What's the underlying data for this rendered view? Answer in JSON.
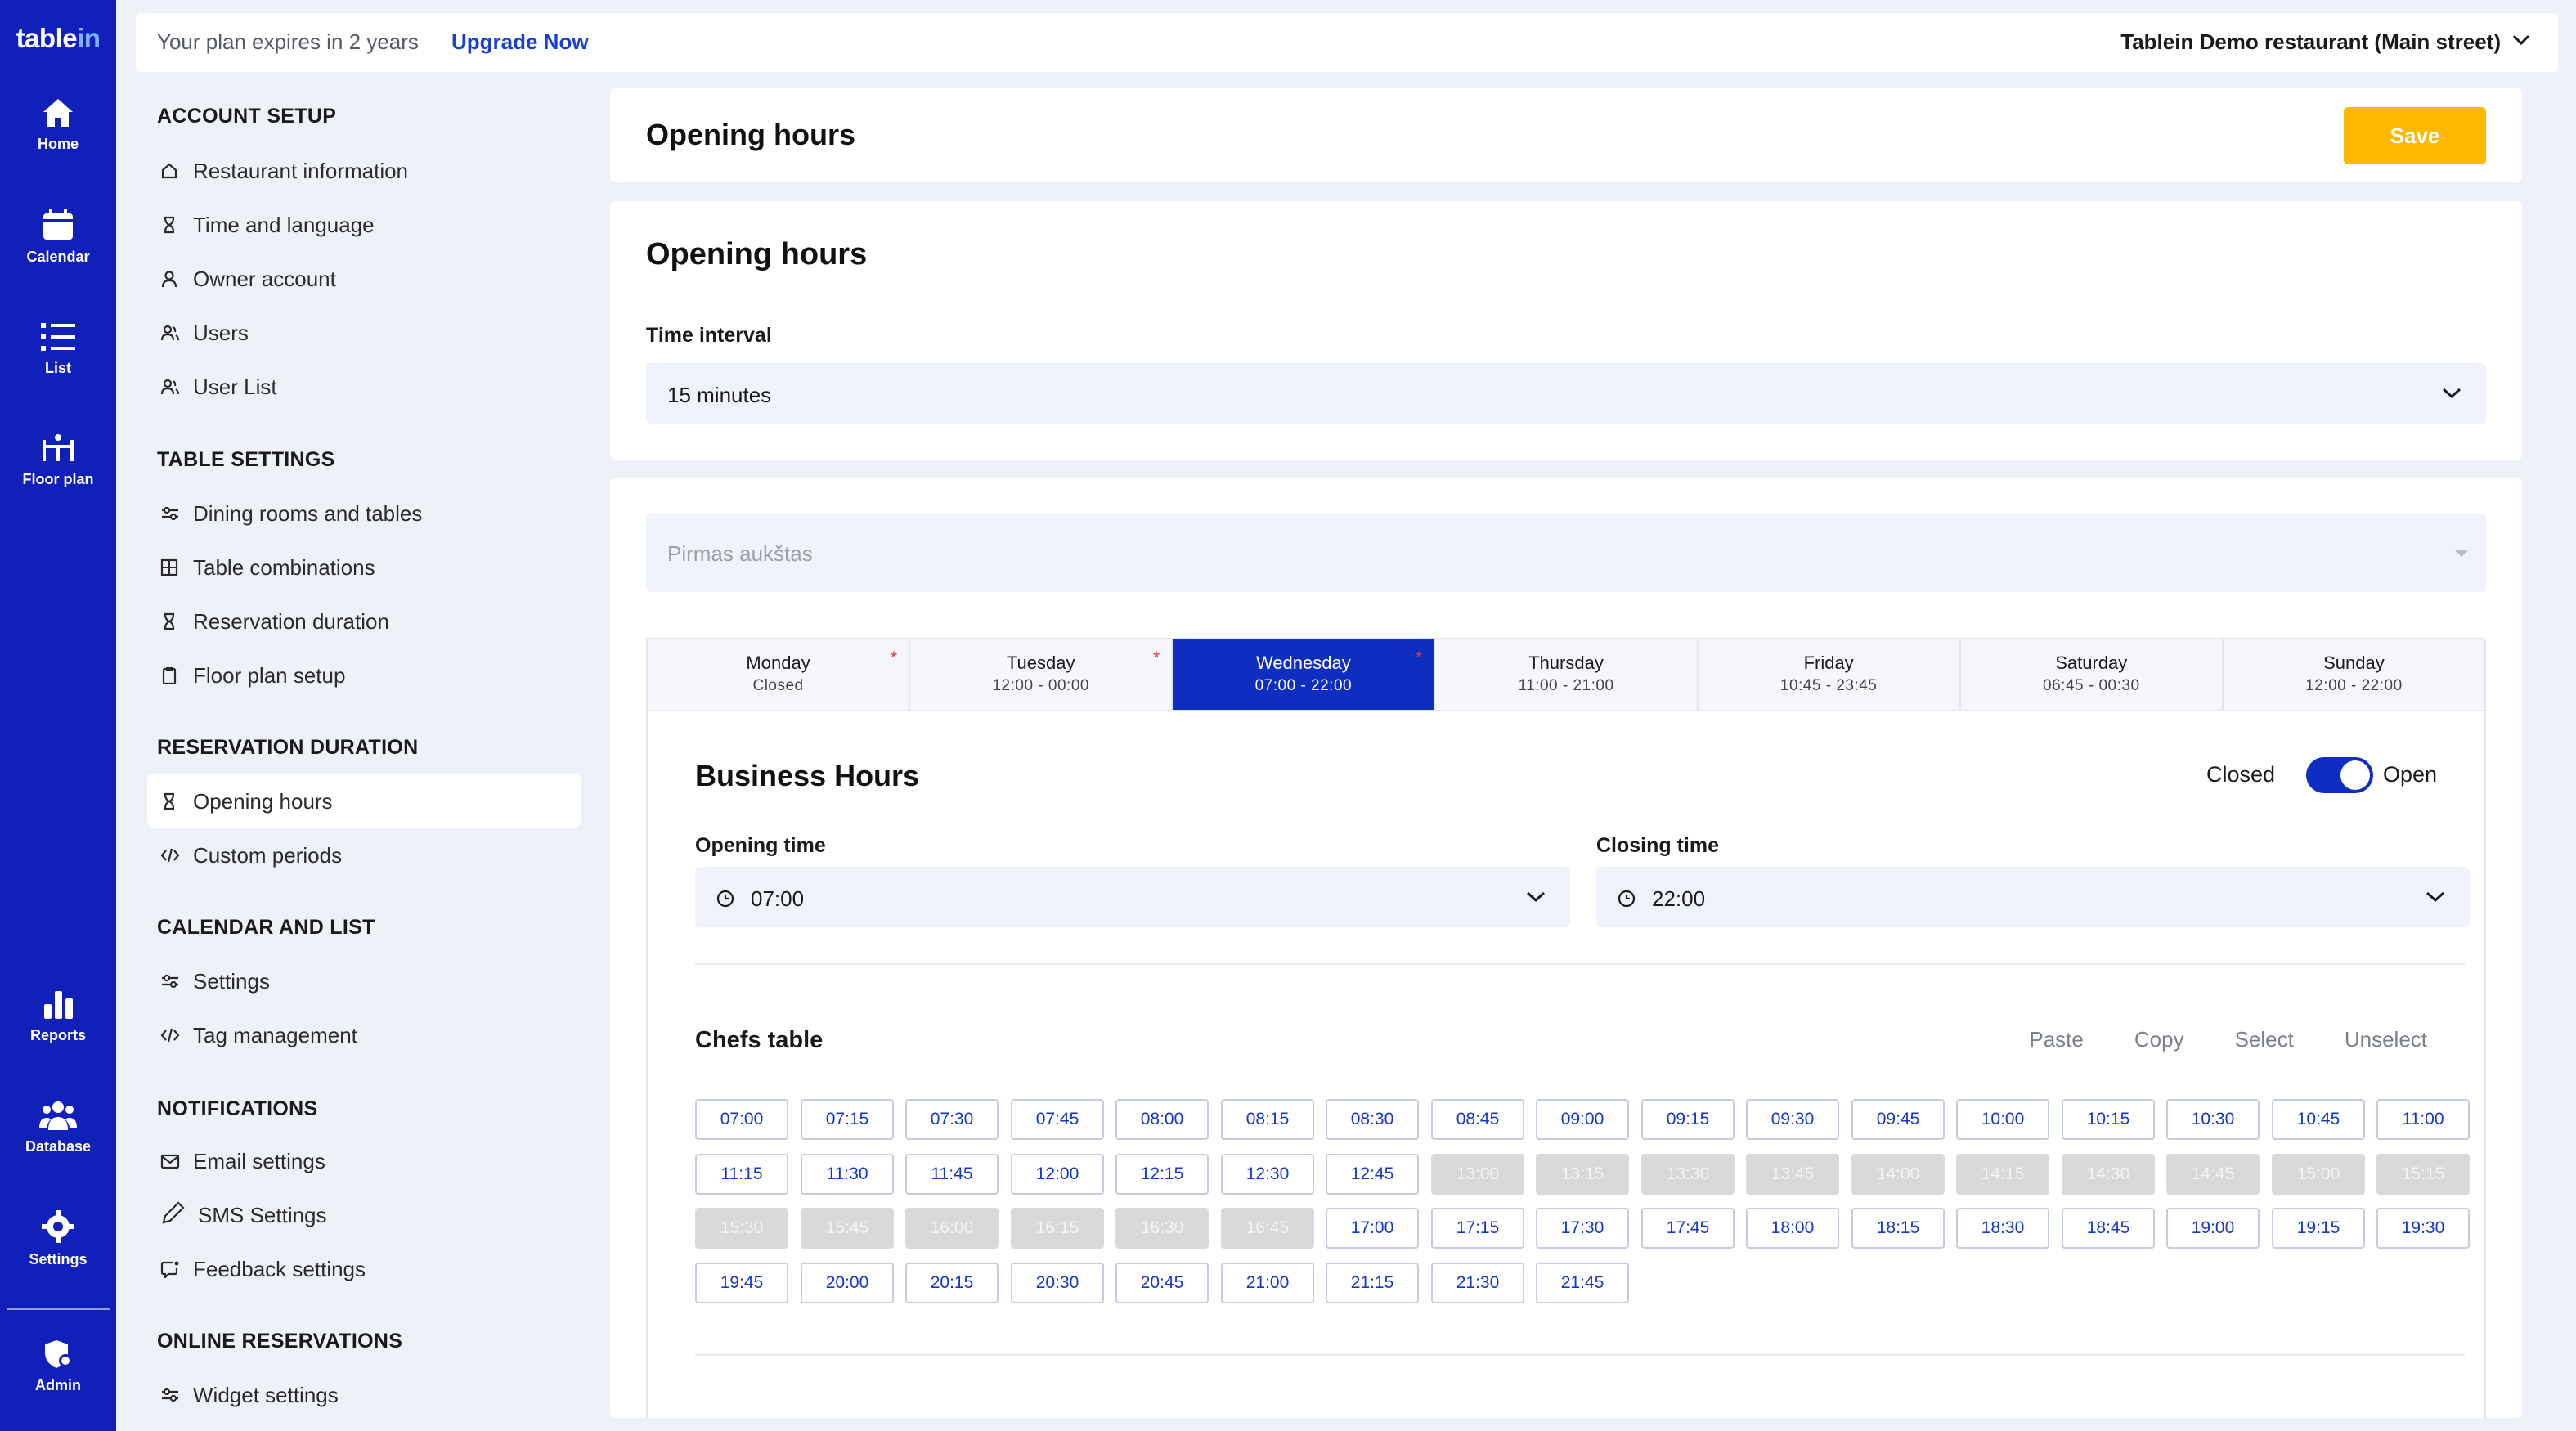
{
  "rail": {
    "logo_a": "table",
    "logo_b": "in",
    "items": [
      {
        "label": "Home",
        "icon": "home-icon"
      },
      {
        "label": "Calendar",
        "icon": "calendar-icon"
      },
      {
        "label": "List",
        "icon": "list-icon"
      },
      {
        "label": "Floor plan",
        "icon": "floor-plan-icon"
      },
      {
        "label": "Reports",
        "icon": "reports-icon"
      },
      {
        "label": "Database",
        "icon": "database-icon"
      },
      {
        "label": "Settings",
        "icon": "settings-icon"
      },
      {
        "label": "Admin",
        "icon": "admin-icon"
      }
    ]
  },
  "topbar": {
    "plan_text": "Your plan expires in 2 years",
    "upgrade_label": "Upgrade Now",
    "restaurant_name": "Tablein Demo restaurant (Main street)"
  },
  "nav": {
    "sections": [
      {
        "title": "ACCOUNT SETUP",
        "items": [
          {
            "label": "Restaurant information",
            "icon": "house-outline-icon"
          },
          {
            "label": "Time and language",
            "icon": "hourglass-icon"
          },
          {
            "label": "Owner account",
            "icon": "user-icon"
          },
          {
            "label": "Users",
            "icon": "users-icon"
          },
          {
            "label": "User List",
            "icon": "users-icon"
          }
        ]
      },
      {
        "title": "TABLE SETTINGS",
        "items": [
          {
            "label": "Dining rooms and tables",
            "icon": "sliders-icon"
          },
          {
            "label": "Table combinations",
            "icon": "grid-icon"
          },
          {
            "label": "Reservation duration",
            "icon": "hourglass-icon"
          },
          {
            "label": "Floor plan setup",
            "icon": "clipboard-icon"
          }
        ]
      },
      {
        "title": "RESERVATION DURATION",
        "items": [
          {
            "label": "Opening hours",
            "icon": "hourglass-icon",
            "active": true
          },
          {
            "label": "Custom periods",
            "icon": "code-icon"
          }
        ]
      },
      {
        "title": "CALENDAR AND LIST",
        "items": [
          {
            "label": "Settings",
            "icon": "sliders-icon"
          },
          {
            "label": "Tag management",
            "icon": "code-icon"
          }
        ]
      },
      {
        "title": "NOTIFICATIONS",
        "items": [
          {
            "label": "Email settings",
            "icon": "mail-icon"
          },
          {
            "label": "SMS Settings",
            "icon": "pen-icon"
          },
          {
            "label": "Feedback settings",
            "icon": "feedback-icon"
          }
        ]
      },
      {
        "title": "ONLINE RESERVATIONS",
        "items": [
          {
            "label": "Widget settings",
            "icon": "sliders-icon"
          }
        ]
      }
    ]
  },
  "header": {
    "title": "Opening hours",
    "save_label": "Save"
  },
  "opening_hours": {
    "title": "Opening hours",
    "interval_label": "Time interval",
    "interval_value": "15 minutes"
  },
  "rooms": {
    "placeholder": "Pirmas aukštas",
    "days": [
      {
        "day": "Monday",
        "hours": "Closed",
        "star": true
      },
      {
        "day": "Tuesday",
        "hours": "12:00 - 00:00",
        "star": true
      },
      {
        "day": "Wednesday",
        "hours": "07:00 - 22:00",
        "star": true,
        "active": true
      },
      {
        "day": "Thursday",
        "hours": "11:00 - 21:00",
        "star": false
      },
      {
        "day": "Friday",
        "hours": "10:45 - 23:45",
        "star": false
      },
      {
        "day": "Saturday",
        "hours": "06:45 - 00:30",
        "star": false
      },
      {
        "day": "Sunday",
        "hours": "12:00 - 22:00",
        "star": false
      }
    ]
  },
  "business_hours": {
    "title": "Business Hours",
    "closed_label": "Closed",
    "open_label": "Open",
    "toggle_on": true,
    "opening_label": "Opening time",
    "opening_value": "07:00",
    "closing_label": "Closing time",
    "closing_value": "22:00"
  },
  "chefs_table": {
    "title": "Chefs table",
    "actions": [
      "Paste",
      "Copy",
      "Select",
      "Unselect"
    ],
    "slots": [
      {
        "t": "07:00",
        "on": true
      },
      {
        "t": "07:15",
        "on": true
      },
      {
        "t": "07:30",
        "on": true
      },
      {
        "t": "07:45",
        "on": true
      },
      {
        "t": "08:00",
        "on": true
      },
      {
        "t": "08:15",
        "on": true
      },
      {
        "t": "08:30",
        "on": true
      },
      {
        "t": "08:45",
        "on": true
      },
      {
        "t": "09:00",
        "on": true
      },
      {
        "t": "09:15",
        "on": true
      },
      {
        "t": "09:30",
        "on": true
      },
      {
        "t": "09:45",
        "on": true
      },
      {
        "t": "10:00",
        "on": true
      },
      {
        "t": "10:15",
        "on": true
      },
      {
        "t": "10:30",
        "on": true
      },
      {
        "t": "10:45",
        "on": true
      },
      {
        "t": "11:00",
        "on": true
      },
      {
        "t": "11:15",
        "on": true
      },
      {
        "t": "11:30",
        "on": true
      },
      {
        "t": "11:45",
        "on": true
      },
      {
        "t": "12:00",
        "on": true
      },
      {
        "t": "12:15",
        "on": true
      },
      {
        "t": "12:30",
        "on": true
      },
      {
        "t": "12:45",
        "on": true
      },
      {
        "t": "13:00",
        "on": false
      },
      {
        "t": "13:15",
        "on": false
      },
      {
        "t": "13:30",
        "on": false
      },
      {
        "t": "13:45",
        "on": false
      },
      {
        "t": "14:00",
        "on": false
      },
      {
        "t": "14:15",
        "on": false
      },
      {
        "t": "14:30",
        "on": false
      },
      {
        "t": "14:45",
        "on": false
      },
      {
        "t": "15:00",
        "on": false
      },
      {
        "t": "15:15",
        "on": false
      },
      {
        "t": "15:30",
        "on": false
      },
      {
        "t": "15:45",
        "on": false
      },
      {
        "t": "16:00",
        "on": false
      },
      {
        "t": "16:15",
        "on": false
      },
      {
        "t": "16:30",
        "on": false
      },
      {
        "t": "16:45",
        "on": false
      },
      {
        "t": "17:00",
        "on": true
      },
      {
        "t": "17:15",
        "on": true
      },
      {
        "t": "17:30",
        "on": true
      },
      {
        "t": "17:45",
        "on": true
      },
      {
        "t": "18:00",
        "on": true
      },
      {
        "t": "18:15",
        "on": true
      },
      {
        "t": "18:30",
        "on": true
      },
      {
        "t": "18:45",
        "on": true
      },
      {
        "t": "19:00",
        "on": true
      },
      {
        "t": "19:15",
        "on": true
      },
      {
        "t": "19:30",
        "on": true
      },
      {
        "t": "19:45",
        "on": true
      },
      {
        "t": "20:00",
        "on": true
      },
      {
        "t": "20:15",
        "on": true
      },
      {
        "t": "20:30",
        "on": true
      },
      {
        "t": "20:45",
        "on": true
      },
      {
        "t": "21:00",
        "on": true
      },
      {
        "t": "21:15",
        "on": true
      },
      {
        "t": "21:30",
        "on": true
      },
      {
        "t": "21:45",
        "on": true
      }
    ]
  },
  "colors": {
    "rail": "#1020b8",
    "accent": "#0d2ec0",
    "save": "#ffb800",
    "link": "#1a3fd6"
  }
}
